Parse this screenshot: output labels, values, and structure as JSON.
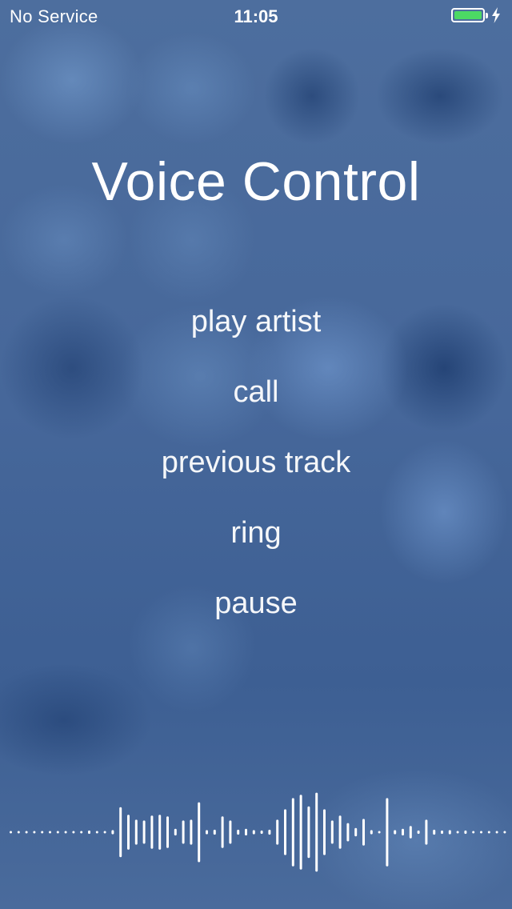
{
  "status_bar": {
    "carrier": "No Service",
    "time": "11:05",
    "battery_level": 1.0,
    "battery_color": "#4cd964",
    "charging": true
  },
  "title": "Voice Control",
  "commands": [
    "play artist",
    "call",
    "previous track",
    "ring",
    "pause"
  ],
  "waveform": {
    "color": "#ffffff",
    "levels": [
      0.02,
      0.02,
      0.02,
      0.02,
      0.02,
      0.02,
      0.02,
      0.02,
      0.02,
      0.02,
      0.04,
      0.02,
      0.02,
      0.05,
      0.6,
      0.42,
      0.3,
      0.28,
      0.4,
      0.42,
      0.38,
      0.08,
      0.28,
      0.3,
      0.72,
      0.05,
      0.06,
      0.38,
      0.28,
      0.06,
      0.08,
      0.05,
      0.04,
      0.06,
      0.3,
      0.55,
      0.82,
      0.9,
      0.62,
      0.95,
      0.55,
      0.28,
      0.4,
      0.22,
      0.1,
      0.32,
      0.05,
      0.02,
      0.82,
      0.05,
      0.08,
      0.15,
      0.04,
      0.3,
      0.06,
      0.04,
      0.05,
      0.02,
      0.04,
      0.02,
      0.02,
      0.02,
      0.02,
      0.02
    ]
  }
}
